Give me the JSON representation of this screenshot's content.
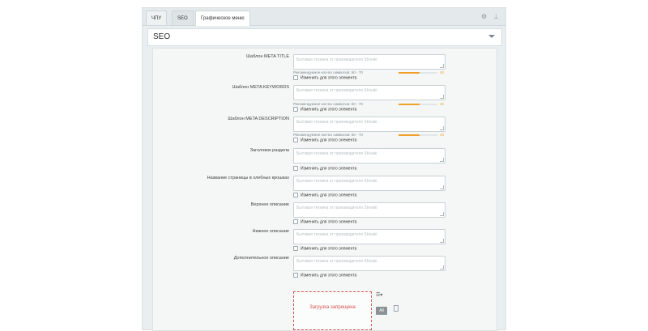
{
  "tabs": [
    {
      "label": "ЧПУ"
    },
    {
      "label": "SEO"
    },
    {
      "label": "Графическое меню"
    }
  ],
  "section": {
    "title": "SEO"
  },
  "placeholder": "Бытовая техника от производителя Shivaki",
  "hint_text": "Рекомендуемое кол-во символов: 50 - 70",
  "hint_count": "40",
  "checkbox_label": "Изменить для этого элемента",
  "fields": [
    {
      "label": "Шаблон META TITLE"
    },
    {
      "label": "Шаблон META KEYWORDS"
    },
    {
      "label": "Шаблон META DESCRIPTION"
    },
    {
      "label": "Заголовок раздела"
    },
    {
      "label": "Название страницы в хлебных крошках"
    },
    {
      "label": "Верхнее описание"
    },
    {
      "label": "Нижнее описание"
    },
    {
      "label": "Дополнительное описание"
    }
  ],
  "upload": {
    "text": "Загрузка запрещена",
    "button_label": "All"
  },
  "progress_fraction": 0.55,
  "icons": {
    "settings": "gear-icon",
    "pin": "pin-icon",
    "menu": "menu-icon",
    "doc": "document-icon"
  }
}
